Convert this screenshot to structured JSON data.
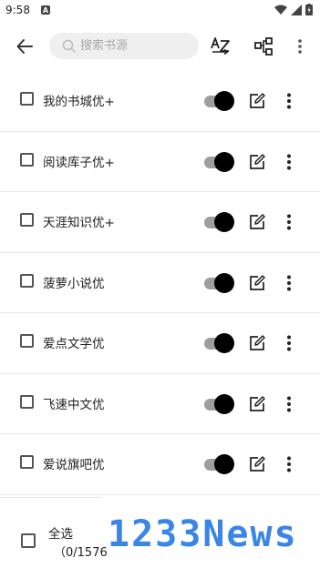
{
  "status_bar": {
    "time": "9:58",
    "notification_letter": "A"
  },
  "toolbar": {
    "search_placeholder": "搜索书源",
    "sort_icon": "sort-az-icon",
    "group_icon": "group-icon",
    "more_icon": "more-vert-icon"
  },
  "sources": [
    {
      "name": "我的书城优+",
      "checked": false,
      "enabled": true
    },
    {
      "name": "阅读库子优+",
      "checked": false,
      "enabled": true
    },
    {
      "name": "天涯知识优+",
      "checked": false,
      "enabled": true
    },
    {
      "name": "菠萝小说优",
      "checked": false,
      "enabled": true
    },
    {
      "name": "爱点文学优",
      "checked": false,
      "enabled": true
    },
    {
      "name": "飞速中文优",
      "checked": false,
      "enabled": true
    },
    {
      "name": "爱说旗吧优",
      "checked": false,
      "enabled": true
    }
  ],
  "footer": {
    "select_all_label": "全选",
    "selection_count": "（0/1576",
    "watermark": "1233News"
  },
  "colors": {
    "switch_thumb": "#000000",
    "switch_track": "#9e9e9e",
    "watermark": "#3a86e6"
  }
}
